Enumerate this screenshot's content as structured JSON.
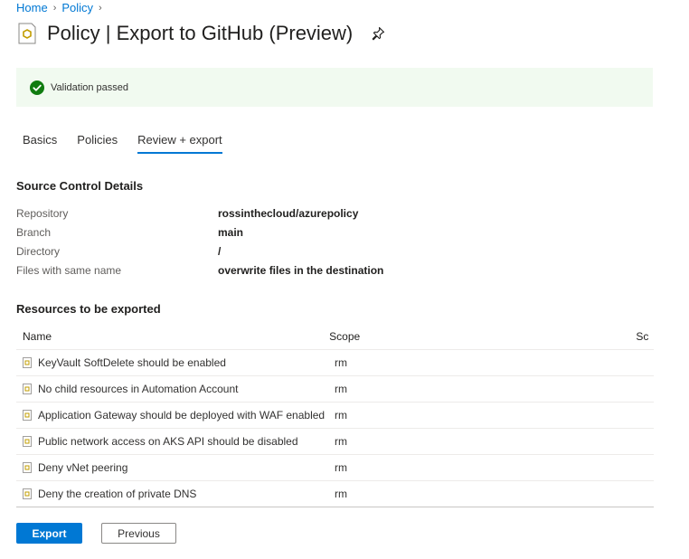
{
  "breadcrumb": {
    "items": [
      "Home",
      "Policy"
    ]
  },
  "header": {
    "title": "Policy | Export to GitHub (Preview)",
    "icon": "policy-icon",
    "pin_icon": "pin-icon"
  },
  "banner": {
    "text": "Validation passed",
    "icon": "check-circle-icon",
    "color": "#107c10"
  },
  "tabs": [
    {
      "label": "Basics",
      "active": false
    },
    {
      "label": "Policies",
      "active": false
    },
    {
      "label": "Review + export",
      "active": true
    }
  ],
  "source_control": {
    "title": "Source Control Details",
    "rows": [
      {
        "label": "Repository",
        "value": "rossinthecloud/azurepolicy"
      },
      {
        "label": "Branch",
        "value": "main"
      },
      {
        "label": "Directory",
        "value": "/"
      },
      {
        "label": "Files with same name",
        "value": "overwrite files in the destination"
      }
    ]
  },
  "resources": {
    "title": "Resources to be exported",
    "columns": [
      "Name",
      "Scope",
      "Sc"
    ],
    "rows": [
      {
        "name": "KeyVault SoftDelete should be enabled",
        "scope": "rm"
      },
      {
        "name": "No child resources in Automation Account",
        "scope": "rm"
      },
      {
        "name": "Application Gateway should be deployed with WAF enabled",
        "scope": "rm"
      },
      {
        "name": "Public network access on AKS API should be disabled",
        "scope": "rm"
      },
      {
        "name": "Deny vNet peering",
        "scope": "rm"
      },
      {
        "name": "Deny the creation of private DNS",
        "scope": "rm"
      }
    ]
  },
  "footer": {
    "export_label": "Export",
    "previous_label": "Previous"
  },
  "colors": {
    "accent": "#0078d4",
    "success_bg": "#f1faf0",
    "success": "#107c10"
  }
}
